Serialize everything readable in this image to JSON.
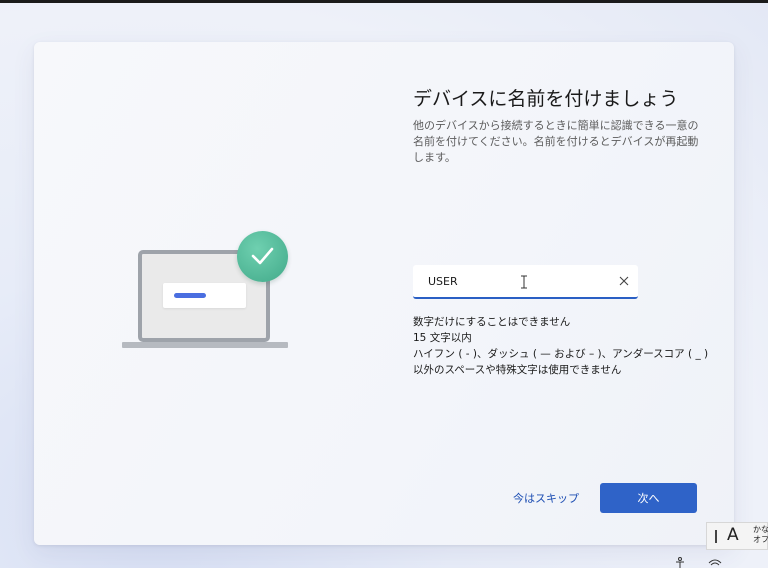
{
  "page": {
    "title": "デバイスに名前を付けましょう",
    "description": "他のデバイスから接続するときに簡単に認識できる一意の名前を付けてください。名前を付けるとデバイスが再起動します。"
  },
  "name_field": {
    "value": "USER",
    "clear_icon": "close-icon"
  },
  "rules": [
    "数字だけにすることはできません",
    "15 文字以内",
    "ハイフン ( - )、ダッシュ ( — および – )、アンダースコア ( _ )",
    "以外のスペースや特殊文字は使用できません"
  ],
  "buttons": {
    "skip": "今はスキップ",
    "next": "次へ"
  },
  "ime": {
    "mode": "A",
    "label_line1": "かな",
    "label_line2": "オフ"
  },
  "colors": {
    "accent": "#2f63c8",
    "check_badge": "#4fb595"
  }
}
